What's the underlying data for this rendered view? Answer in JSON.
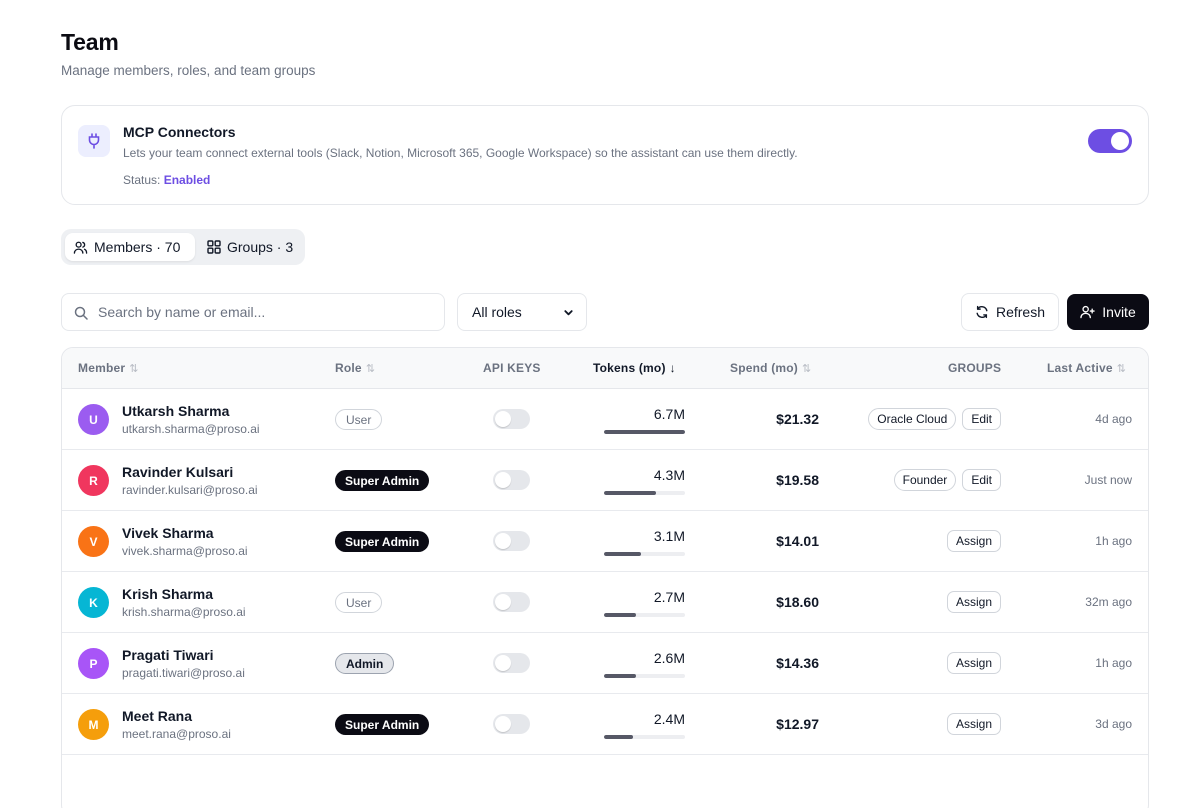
{
  "header": {
    "title": "Team",
    "subtitle": "Manage members, roles, and team groups"
  },
  "mcp": {
    "title": "MCP Connectors",
    "description": "Lets your team connect external tools (Slack, Notion, Microsoft 365, Google Workspace) so the assistant can use them directly.",
    "status_label": "Status:",
    "status_value": "Enabled",
    "enabled": true
  },
  "tabs": [
    {
      "label": "Members · 70",
      "icon": "users-icon",
      "active": true
    },
    {
      "label": "Groups · 3",
      "icon": "grid-icon",
      "active": false
    }
  ],
  "toolbar": {
    "search_placeholder": "Search by name or email...",
    "role_filter": "All roles",
    "refresh_label": "Refresh",
    "invite_label": "Invite"
  },
  "columns": {
    "member": "Member",
    "role": "Role",
    "api_keys": "API KEYS",
    "tokens": "Tokens (mo)",
    "spend": "Spend (mo)",
    "groups": "GROUPS",
    "last_active": "Last Active"
  },
  "colors": {
    "accent": "#6d4ee3",
    "dark": "#0b0b14"
  },
  "members": [
    {
      "initial": "U",
      "avatar_color": "#9b5cf0",
      "name": "Utkarsh Sharma",
      "email": "utkarsh.sharma@proso.ai",
      "role": "User",
      "role_style": "user",
      "api_keys_enabled": false,
      "tokens": "6.7M",
      "token_share": 1.0,
      "spend": "$21.32",
      "groups": [
        "Oracle Cloud",
        "Edit"
      ],
      "last_active": "4d ago"
    },
    {
      "initial": "R",
      "avatar_color": "#f0365e",
      "name": "Ravinder Kulsari",
      "email": "ravinder.kulsari@proso.ai",
      "role": "Super Admin",
      "role_style": "super",
      "api_keys_enabled": false,
      "tokens": "4.3M",
      "token_share": 0.64,
      "spend": "$19.58",
      "groups": [
        "Founder",
        "Edit"
      ],
      "last_active": "Just now"
    },
    {
      "initial": "V",
      "avatar_color": "#f97316",
      "name": "Vivek Sharma",
      "email": "vivek.sharma@proso.ai",
      "role": "Super Admin",
      "role_style": "super",
      "api_keys_enabled": false,
      "tokens": "3.1M",
      "token_share": 0.46,
      "spend": "$14.01",
      "groups": [
        "Assign"
      ],
      "last_active": "1h ago"
    },
    {
      "initial": "K",
      "avatar_color": "#06b6d4",
      "name": "Krish Sharma",
      "email": "krish.sharma@proso.ai",
      "role": "User",
      "role_style": "user",
      "api_keys_enabled": false,
      "tokens": "2.7M",
      "token_share": 0.4,
      "spend": "$18.60",
      "groups": [
        "Assign"
      ],
      "last_active": "32m ago"
    },
    {
      "initial": "P",
      "avatar_color": "#a855f7",
      "name": "Pragati Tiwari",
      "email": "pragati.tiwari@proso.ai",
      "role": "Admin",
      "role_style": "admin",
      "api_keys_enabled": false,
      "tokens": "2.6M",
      "token_share": 0.39,
      "spend": "$14.36",
      "groups": [
        "Assign"
      ],
      "last_active": "1h ago"
    },
    {
      "initial": "M",
      "avatar_color": "#f59e0b",
      "name": "Meet Rana",
      "email": "meet.rana@proso.ai",
      "role": "Super Admin",
      "role_style": "super",
      "api_keys_enabled": false,
      "tokens": "2.4M",
      "token_share": 0.36,
      "spend": "$12.97",
      "groups": [
        "Assign"
      ],
      "last_active": "3d ago"
    }
  ]
}
